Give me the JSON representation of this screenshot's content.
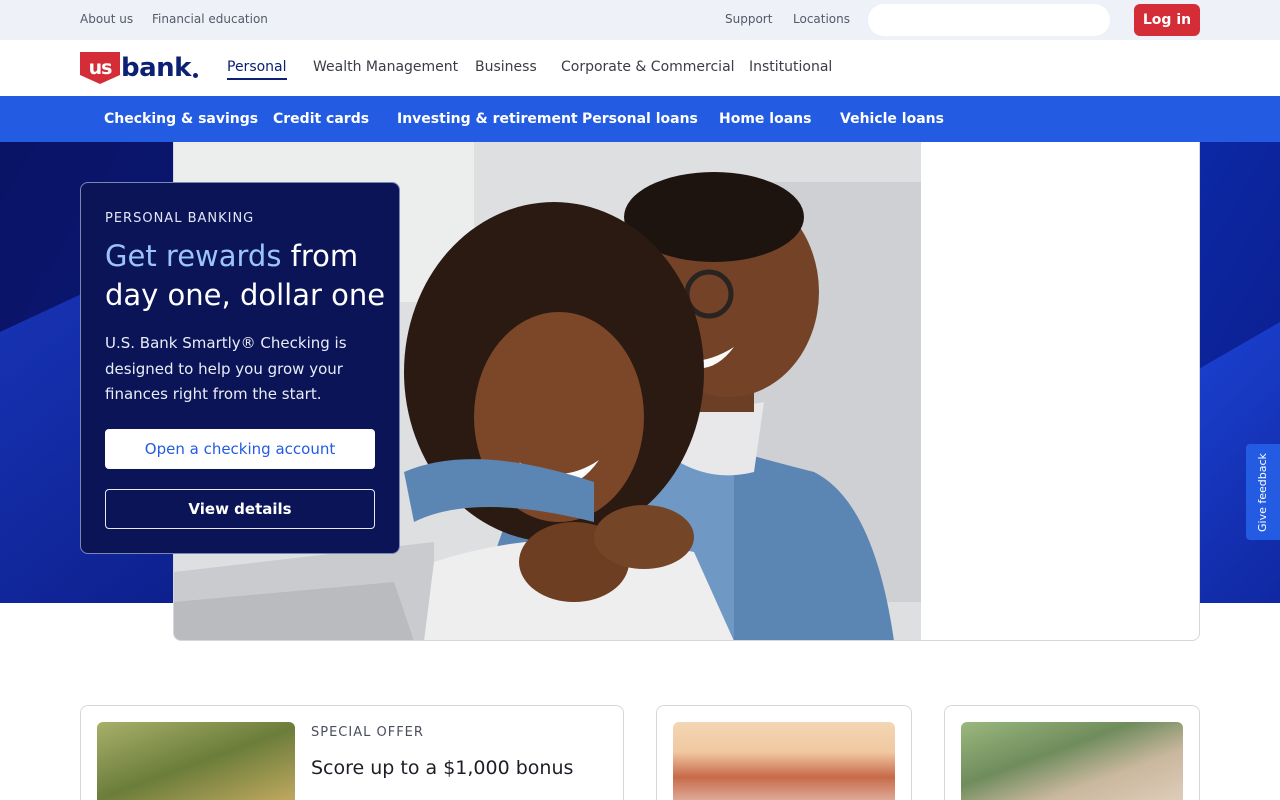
{
  "utility": {
    "links": [
      "About us",
      "Financial education"
    ],
    "right_links": [
      "Support",
      "Locations"
    ],
    "search_placeholder": "",
    "login_label": "Log in"
  },
  "brand": {
    "logo_text_shield": "us",
    "logo_text_word": "bank"
  },
  "main_nav": [
    "Personal",
    "Wealth Management",
    "Business",
    "Corporate & Commercial",
    "Institutional"
  ],
  "category_nav": [
    "Checking & savings",
    "Credit cards",
    "Investing & retirement",
    "Personal loans",
    "Home loans",
    "Vehicle loans"
  ],
  "hero": {
    "eyebrow": "PERSONAL BANKING",
    "headline_highlight": "Get rewards",
    "headline_rest": " from day one, dollar one",
    "description": "U.S. Bank Smartly® Checking is designed to help you grow your finances right from the start.",
    "primary_cta": "Open a checking account",
    "secondary_cta": "View details"
  },
  "feedback_label": "Give feedback",
  "offer_card": {
    "eyebrow": "SPECIAL OFFER",
    "title": "Score up to a $1,000 bonus"
  },
  "colors": {
    "brand_red": "#d42d38",
    "brand_navy": "#0c2074",
    "category_blue": "#235be2",
    "hero_card_bg": "#0a1457"
  }
}
